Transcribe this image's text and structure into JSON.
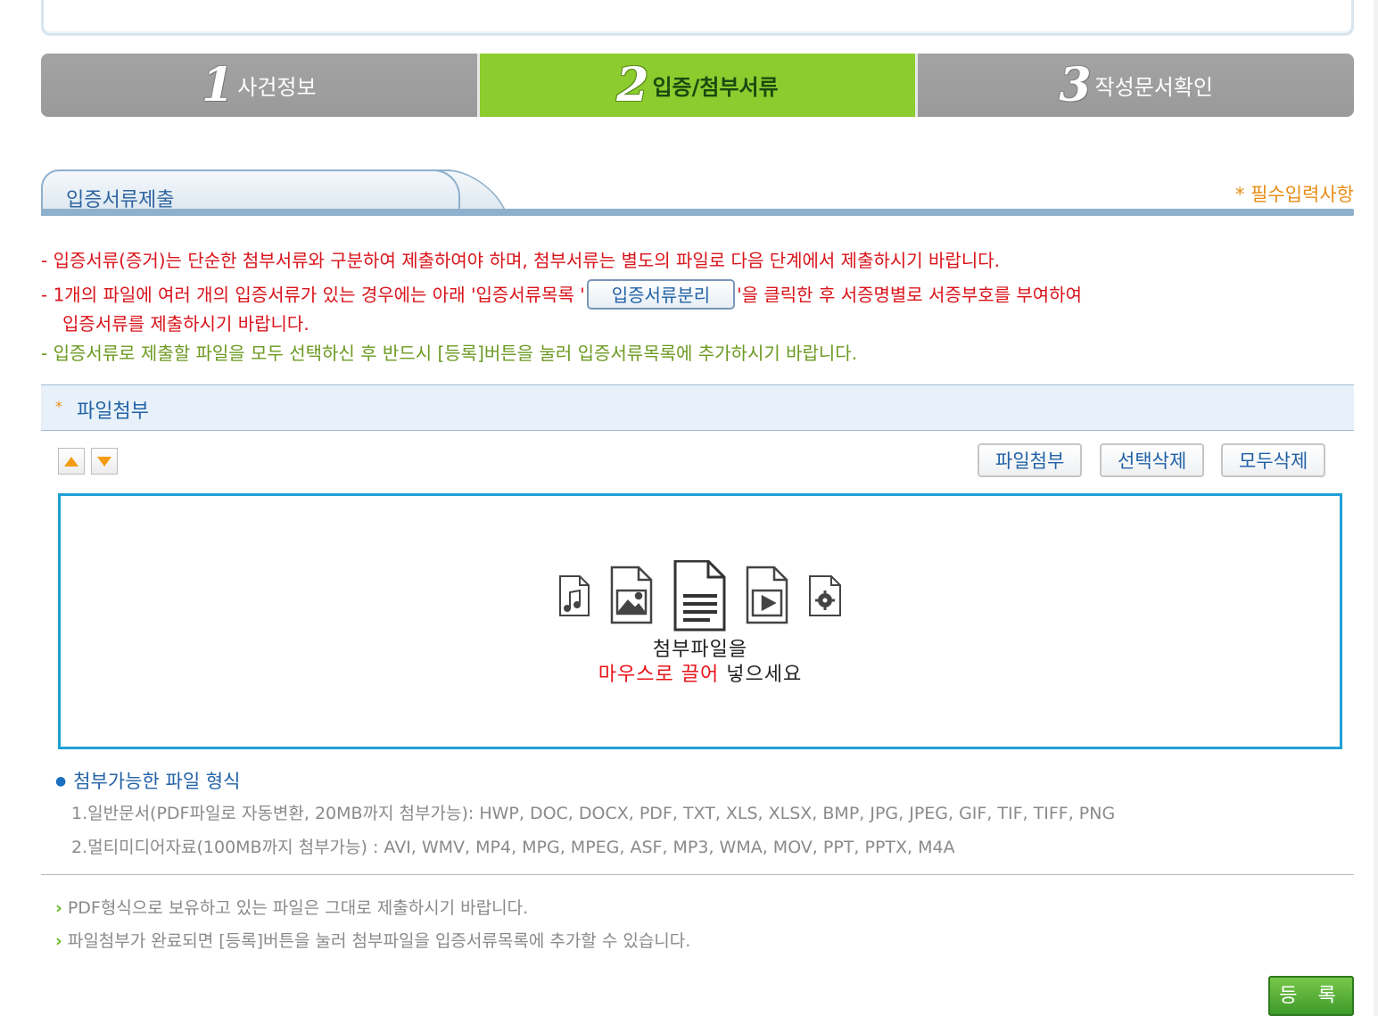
{
  "steps": [
    {
      "num": "1",
      "label": "사건정보"
    },
    {
      "num": "2",
      "label": "입증/첨부서류"
    },
    {
      "num": "3",
      "label": "작성문서확인"
    }
  ],
  "section": {
    "title": "입증서류제출",
    "required_note": "* 필수입력사항"
  },
  "notices": {
    "line1": "- 입증서류(증거)는 단순한 첨부서류와 구분하여 제출하여야 하며, 첨부서류는 별도의 파일로 다음 단계에서 제출하시기 바랍니다.",
    "line2_before": "- 1개의 파일에 여러 개의 입증서류가 있는 경우에는 아래 '입증서류목록 '",
    "split_button": "입증서류분리",
    "line2_after": "'을 클릭한 후 서증명별로 서증부호를 부여하여",
    "line3": "입증서류를 제출하시기 바랍니다.",
    "line4": "- 입증서류로 제출할 파일을 모두 선택하신 후 반드시 [등록]버튼을 눌러 입증서류목록에 추가하시기 바랍니다."
  },
  "attach": {
    "star": "*",
    "title": "파일첨부",
    "buttons": {
      "attach": "파일첨부",
      "delete_selected": "선택삭제",
      "delete_all": "모두삭제"
    }
  },
  "drop_zone": {
    "line1": "첨부파일을",
    "line2_emphasis": "마우스로 끌어",
    "line2_rest": " 넣으세요",
    "icons": [
      "audio-file-icon",
      "image-file-icon",
      "document-file-icon",
      "video-file-icon",
      "settings-file-icon"
    ]
  },
  "formats": {
    "title": "첨부가능한 파일 형식",
    "line1": "1.일반문서(PDF파일로 자동변환, 20MB까지 첨부가능): HWP, DOC, DOCX, PDF, TXT, XLS, XLSX, BMP, JPG, JPEG, GIF, TIF, TIFF, PNG",
    "line2": "2.멀티미디어자료(100MB까지 첨부가능) : AVI, WMV, MP4, MPG, MPEG, ASF, MP3, WMA, MOV, PPT, PPTX, M4A"
  },
  "tips": [
    "PDF형식으로 보유하고 있는 파일은 그대로 제출하시기 바랍니다.",
    "파일첨부가 완료되면 [등록]버튼을 눌러 첨부파일을 입증서류목록에 추가할 수 있습니다."
  ],
  "register_label": "등 록",
  "colors": {
    "step_active": "#8ccc2e",
    "step_inactive": "#a0a0a0",
    "notice_red": "#d9141b",
    "notice_green": "#6c9a22",
    "drop_border": "#1fa0d6",
    "link_blue": "#2262a6",
    "register_green": "#4aa832"
  }
}
